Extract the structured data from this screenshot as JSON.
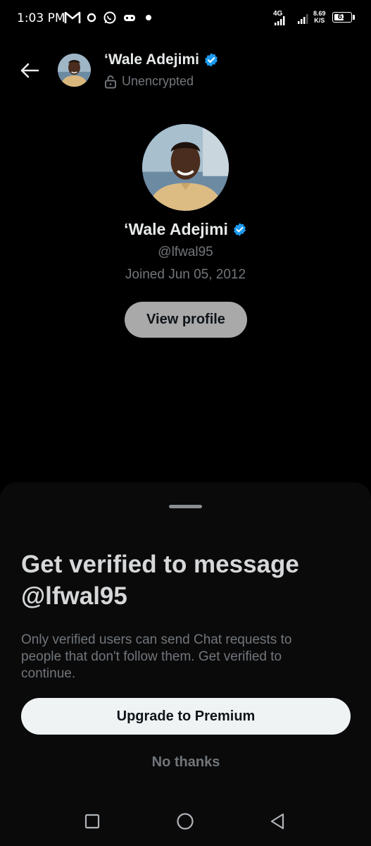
{
  "status_bar": {
    "time": "1:03 PM",
    "network": "4G",
    "speed_value": "8.69",
    "speed_unit": "K/S",
    "battery": "61",
    "battery_level": 0.61,
    "icons": [
      "gmail-icon",
      "sync-icon",
      "whatsapp-icon",
      "game-controller-icon",
      "notification-dot-icon"
    ]
  },
  "header": {
    "name": "‘Wale Adejimi",
    "subtitle": "Unencrypted",
    "verified_color": "#1d9bf0"
  },
  "profile": {
    "name": "‘Wale Adejimi",
    "handle": "@lfwal95",
    "joined": "Joined Jun 05, 2012",
    "view_profile_label": "View profile"
  },
  "sheet": {
    "title": "Get verified to message @lfwal95",
    "body": "Only verified users can send Chat requests to people that don't follow them. Get verified to continue.",
    "upgrade_label": "Upgrade to Premium",
    "no_thanks_label": "No thanks"
  },
  "nav": {
    "icons": [
      "recent-apps-icon",
      "home-icon",
      "back-icon"
    ]
  }
}
